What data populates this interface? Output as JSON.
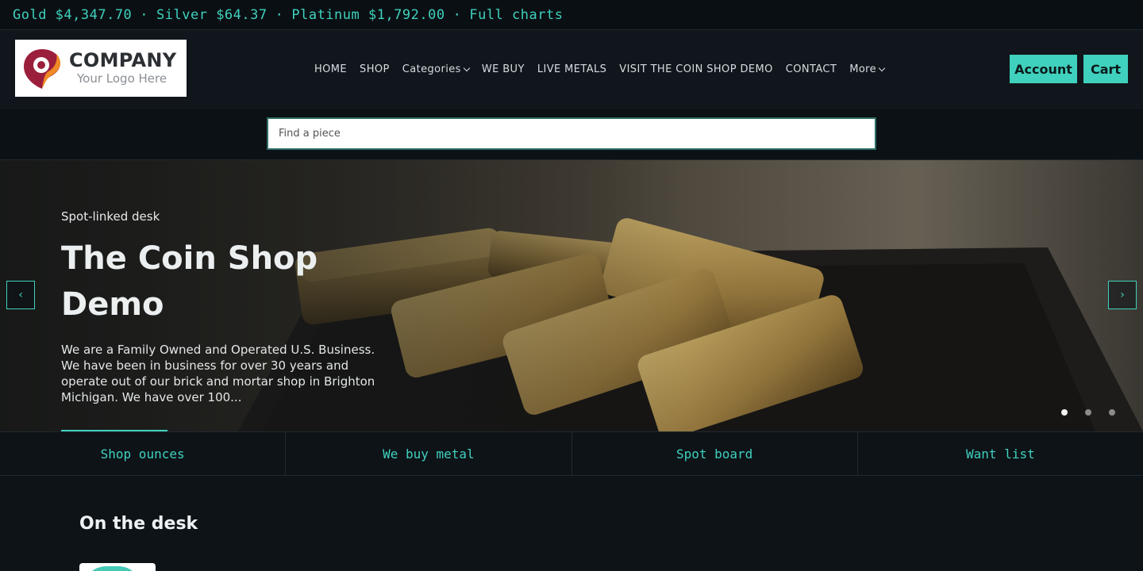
{
  "ticker": {
    "gold": "Gold $4,347.70",
    "silver": "Silver $64.37",
    "platinum": "Platinum $1,792.00",
    "charts_link": "Full charts",
    "separator": "·"
  },
  "logo": {
    "company": "COMPANY",
    "tagline": "Your Logo Here"
  },
  "nav": {
    "items": [
      {
        "label": "HOME"
      },
      {
        "label": "SHOP"
      },
      {
        "label": "Categories"
      },
      {
        "label": "WE BUY"
      },
      {
        "label": "LIVE METALS"
      },
      {
        "label": "VISIT THE COIN SHOP DEMO"
      },
      {
        "label": "CONTACT"
      },
      {
        "label": "More"
      }
    ]
  },
  "header": {
    "account_label": "Account",
    "cart_label": "Cart"
  },
  "search": {
    "placeholder": "Find a piece",
    "value": ""
  },
  "hero": {
    "eyebrow": "Spot-linked desk",
    "title": "The Coin Shop Demo",
    "text": "We are a Family Owned and Operated U.S. Business. We have been in business for over 30 years and operate out of our brick and mortar shop in Brighton Michigan. We have over 100...",
    "prev_label": "‹",
    "next_label": "›",
    "slide_count": 3,
    "active_slide": 1
  },
  "quick_links": [
    {
      "label": "Shop ounces"
    },
    {
      "label": "We buy metal"
    },
    {
      "label": "Spot board"
    },
    {
      "label": "Want list"
    }
  ],
  "desk": {
    "title": "On the desk"
  },
  "colors": {
    "accent": "#3fd1bd",
    "background": "#0e1318",
    "header": "#10161b"
  }
}
